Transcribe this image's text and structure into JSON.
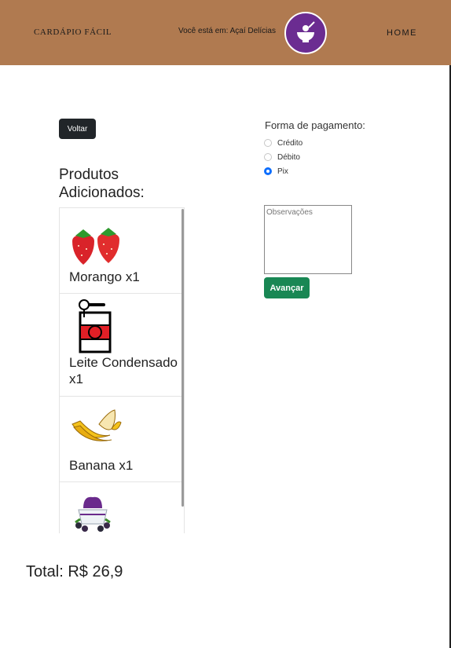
{
  "header": {
    "brand": "CARDÁPIO FÁCIL",
    "location": "Você está em: Açaí Delícias",
    "logo_icon": "acai-bowl-icon",
    "home_label": "HOME",
    "color": "#b07a50"
  },
  "back_button": "Voltar",
  "products_title": "Produtos Adicionados:",
  "products": [
    {
      "name": "Morango x1",
      "icon": "strawberry-icon"
    },
    {
      "name": "Leite Condensado x1",
      "icon": "condensed-milk-can-icon"
    },
    {
      "name": "Banana x1",
      "icon": "banana-icon"
    },
    {
      "name": "",
      "icon": "acai-cup-icon"
    }
  ],
  "payment": {
    "title": "Forma de pagamento:",
    "options": [
      "Crédito",
      "Débito",
      "Pix"
    ],
    "selected": "Pix"
  },
  "observations_placeholder": "Observações",
  "advance_button": "Avançar",
  "total": "Total: R$ 26,9",
  "colors": {
    "accent_purple": "#6b2c91",
    "success": "#198754",
    "primary": "#0d6efd"
  }
}
